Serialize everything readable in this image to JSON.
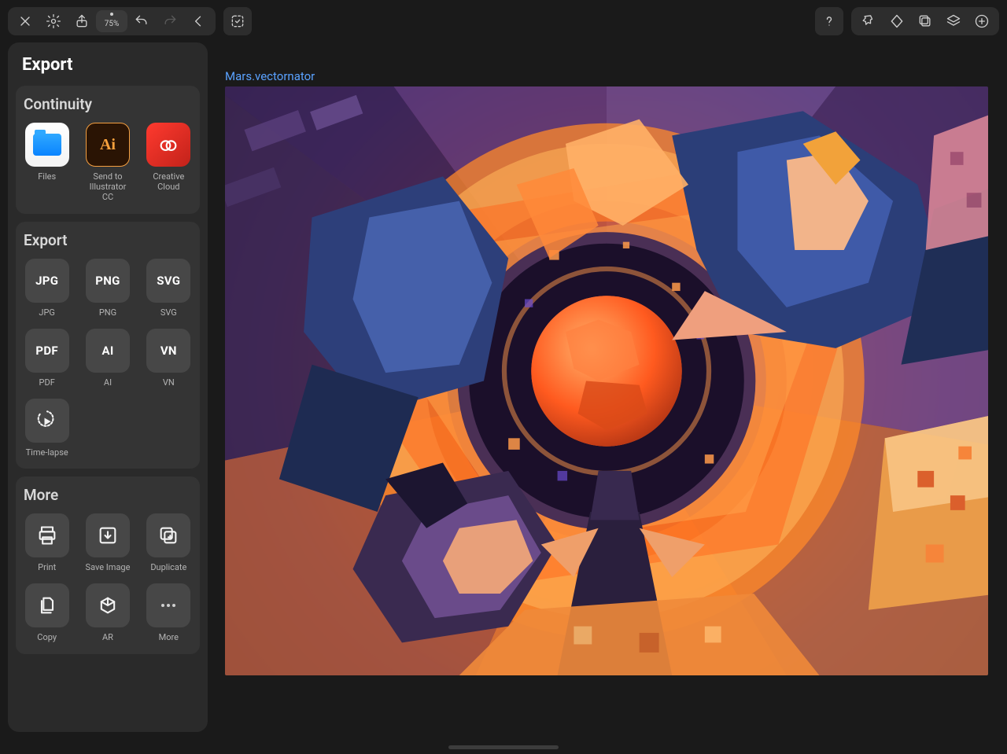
{
  "toolbar": {
    "zoom": "75%"
  },
  "panel": {
    "title": "Export",
    "sections": {
      "continuity": {
        "title": "Continuity",
        "items": [
          {
            "label": "Files"
          },
          {
            "label": "Send to Illustrator CC"
          },
          {
            "label": "Creative Cloud"
          }
        ]
      },
      "export": {
        "title": "Export",
        "items": [
          {
            "tile": "JPG",
            "label": "JPG"
          },
          {
            "tile": "PNG",
            "label": "PNG"
          },
          {
            "tile": "SVG",
            "label": "SVG"
          },
          {
            "tile": "PDF",
            "label": "PDF"
          },
          {
            "tile": "AI",
            "label": "AI"
          },
          {
            "tile": "VN",
            "label": "VN"
          },
          {
            "tile": "",
            "label": "Time-lapse"
          }
        ]
      },
      "more": {
        "title": "More",
        "items": [
          {
            "label": "Print"
          },
          {
            "label": "Save Image"
          },
          {
            "label": "Duplicate"
          },
          {
            "label": "Copy"
          },
          {
            "label": "AR"
          },
          {
            "label": "More"
          }
        ]
      }
    }
  },
  "document": {
    "title": "Mars.vectornator"
  }
}
